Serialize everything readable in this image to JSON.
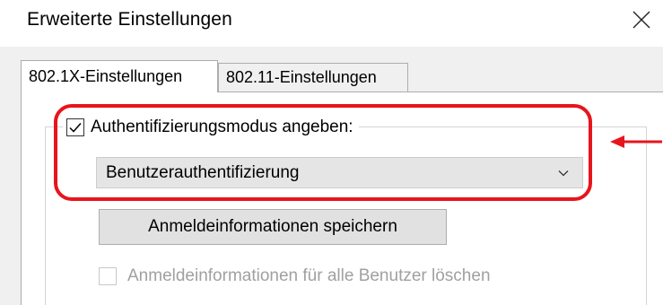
{
  "window": {
    "title": "Erweiterte Einstellungen",
    "close_icon": "close-icon"
  },
  "tabs": [
    {
      "label": "802.1X-Einstellungen",
      "active": true
    },
    {
      "label": "802.11-Einstellungen",
      "active": false
    }
  ],
  "auth_mode": {
    "checkbox_label": "Authentifizierungsmodus angeben:",
    "checked": true,
    "selected_value": "Benutzerauthentifizierung"
  },
  "buttons": {
    "save_credentials": "Anmeldeinformationen speichern"
  },
  "delete_credentials": {
    "label": "Anmeldeinformationen für alle Benutzer löschen",
    "enabled": false
  },
  "annotation": {
    "color": "#e8141c"
  }
}
